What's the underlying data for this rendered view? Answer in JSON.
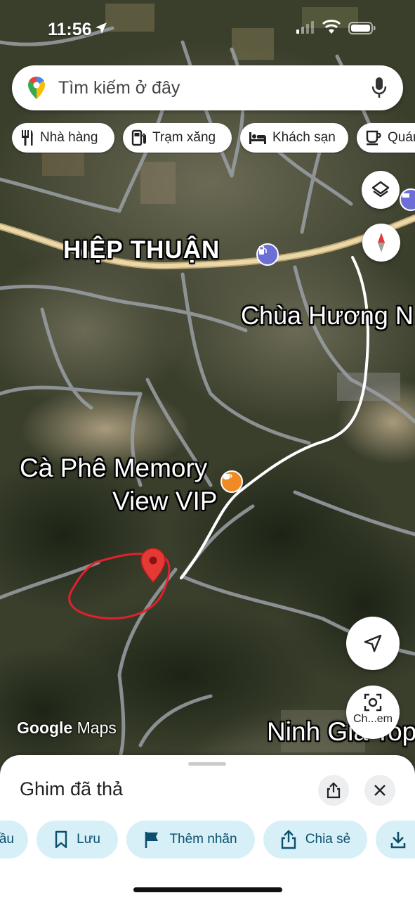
{
  "status_bar": {
    "time": "11:56"
  },
  "search": {
    "placeholder": "Tìm kiếm ở đây"
  },
  "chips": [
    {
      "label": "Nhà hàng",
      "icon": "restaurant-icon"
    },
    {
      "label": "Trạm xăng",
      "icon": "gas-station-icon"
    },
    {
      "label": "Khách sạn",
      "icon": "hotel-icon"
    },
    {
      "label": "Quán",
      "icon": "cafe-icon"
    }
  ],
  "map": {
    "labels": {
      "hiep_thuan": "HIỆP THUẬN",
      "chua_huong": "Chùa Hương N",
      "cafe_line1": "Cà Phê Memory",
      "cafe_line2": "View VIP",
      "ninh_gia": "Ninh Gia Top"
    },
    "watermark_google": "Google",
    "watermark_maps": "Maps",
    "street_view_label": "Ch...em"
  },
  "sheet": {
    "title": "Ghim đã thả",
    "actions": [
      {
        "label": "ầu",
        "icon": "route-icon"
      },
      {
        "label": "Lưu",
        "icon": "bookmark-icon"
      },
      {
        "label": "Thêm nhãn",
        "icon": "flag-icon"
      },
      {
        "label": "Chia sẻ",
        "icon": "share-icon"
      },
      {
        "label": "",
        "icon": "download-icon"
      }
    ]
  },
  "colors": {
    "accent": "#0b4f6c",
    "action_bg": "#d7f0f8",
    "route_line": "#ffffff",
    "pin_red": "#e53935",
    "drawn_outline": "#e3202e",
    "poi_purple": "#6d6fd6",
    "poi_orange": "#f08a24"
  }
}
